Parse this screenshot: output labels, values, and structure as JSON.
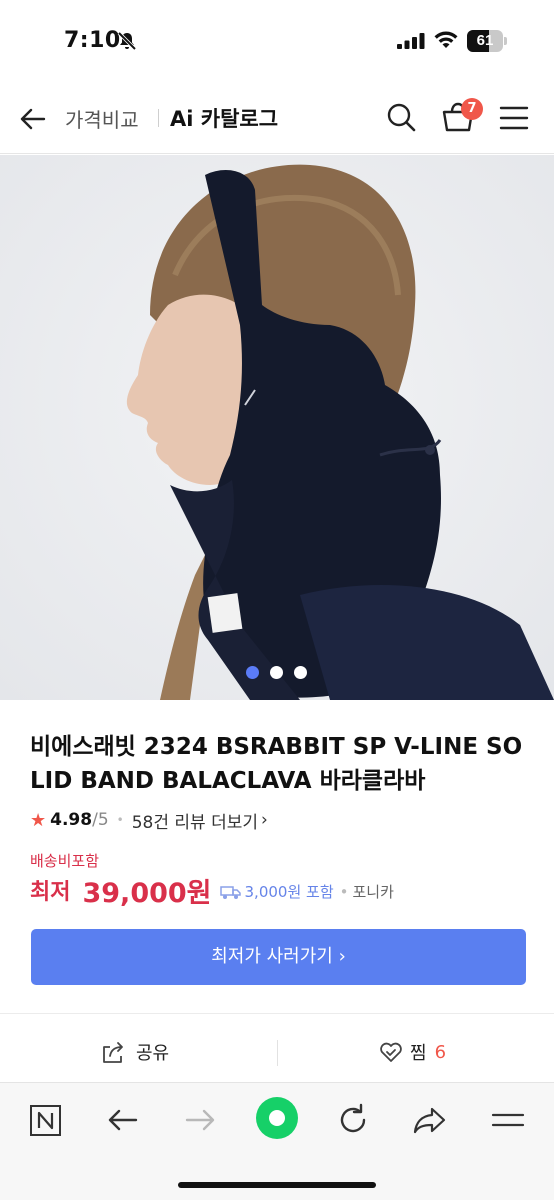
{
  "status_bar": {
    "time": "7:10",
    "battery": "61"
  },
  "header": {
    "crumb": "가격비교",
    "title": "Ai 카탈로그",
    "cart_count": "7"
  },
  "gallery": {
    "image_count": 3,
    "active_index": 0,
    "colors": {
      "active_dot": "#5b7cf7"
    }
  },
  "product": {
    "title": "비에스래빗 2324 BSRABBIT SP V-LINE SOLID BAND BALACLAVA 바라클라바",
    "rating": "4.98",
    "rating_max": "/5",
    "reviews": "58건 리뷰 더보기",
    "shipping_note": "배송비포함",
    "price_label": "최저",
    "price": "39,000원",
    "shipping_fee": "3,000원 포함",
    "seller": "포니카"
  },
  "cta": {
    "label": "최저가 사러가기 ›"
  },
  "actions": {
    "share_label": "공유",
    "like_label": "찜",
    "like_count": "6"
  },
  "colors": {
    "accent": "#5a7ff0",
    "price": "#d9304a",
    "badge": "#f0574a",
    "naver_green": "#16d068"
  },
  "toolbar": {
    "icons": [
      "naver-n-icon",
      "back-arrow-icon",
      "forward-arrow-icon",
      "green-home-icon",
      "reload-icon",
      "share-arrow-icon",
      "menu-icon"
    ]
  }
}
